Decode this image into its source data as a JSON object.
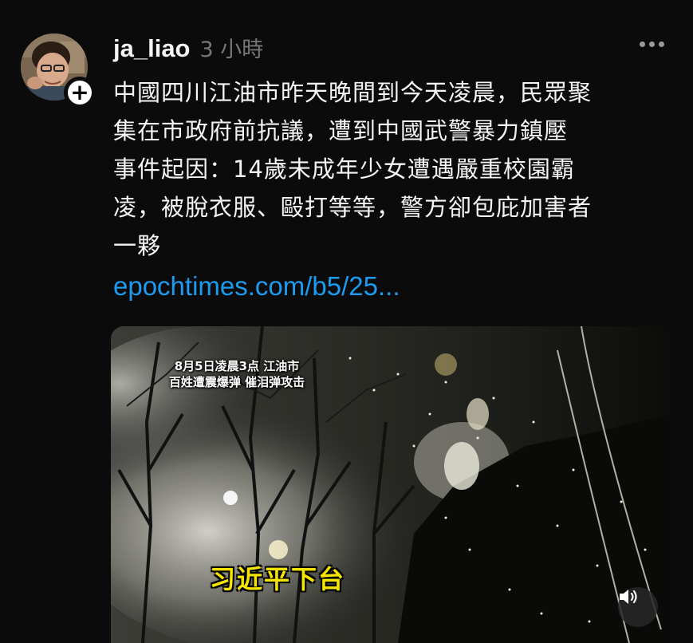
{
  "post": {
    "username": "ja_liao",
    "timestamp": "3 小時",
    "body_lines": [
      "中國四川江油市昨天晚間到今天凌晨，民眾聚",
      "集在市政府前抗議，遭到中國武警暴力鎮壓",
      "事件起因：14歲未成年少女遭遇嚴重校園霸",
      "凌，被脫衣服、毆打等等，警方卻包庇加害者",
      "一夥"
    ],
    "link_text": "epochtimes.com/b5/25..."
  },
  "video": {
    "caption_top_line1": "8月5日凌晨3点 江油市",
    "caption_top_line2": "百姓遭震爆弹 催泪弹攻击",
    "caption_main": "习近平下台"
  },
  "icons": {
    "follow": "plus-icon",
    "more": "more-options-icon",
    "mute": "speaker-icon"
  },
  "colors": {
    "link": "#1d9bf0",
    "caption_main": "#f5e400",
    "background": "#0b0b0b"
  }
}
